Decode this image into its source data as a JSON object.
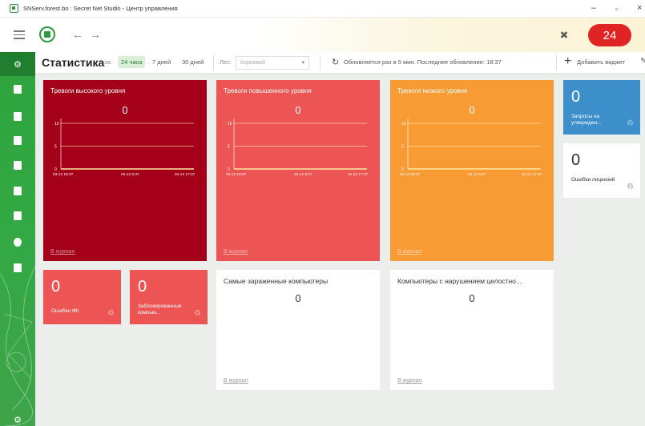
{
  "window": {
    "title": "SNServ.forest.bo : Secret Net Studio - Центр управления",
    "minimize": "–",
    "restore": "▫",
    "close": "×"
  },
  "topbar": {
    "notification_count": "24",
    "back_arrow": "←",
    "forward_arrow": "→"
  },
  "header": {
    "title": "Статистика",
    "for_label": "за:",
    "ranges": [
      "24 часа",
      "7 дней",
      "30 дней"
    ],
    "forest_label": "Лес:",
    "forest_value": "Корневой",
    "refresh_text": "Обновляется раз в 5 мин. Последнее обновление: 18:37",
    "add_widget": "Добавить виджет"
  },
  "colors": {
    "high": "#a4001a",
    "elevated": "#ed5454",
    "low": "#f99b35",
    "blue": "#3d8fcb",
    "sidebar": "#2ea43d",
    "badge": "#e02424"
  },
  "alert_cards": [
    {
      "title": "Тревоги высокого уровня",
      "value": "0",
      "y_ticks": [
        "10",
        "5",
        "0"
      ],
      "x_ticks": [
        "03.12 18:37",
        "04.12 6:37",
        "04.12 17:37"
      ],
      "journal": "В журнал"
    },
    {
      "title": "Тревоги повышенного уровня",
      "value": "0",
      "y_ticks": [
        "10",
        "5",
        "0"
      ],
      "x_ticks": [
        "03.12 18:37",
        "04.12 6:37",
        "04.12 17:37"
      ],
      "journal": "В журнал"
    },
    {
      "title": "Тревоги низкого уровня",
      "value": "0",
      "y_ticks": [
        "10",
        "5",
        "0"
      ],
      "x_ticks": [
        "03.12 18:37",
        "04.12 6:37",
        "04.12 17:37"
      ],
      "journal": "В журнал"
    }
  ],
  "small_cards": [
    {
      "value": "0",
      "label": "Запросы на утвержден...",
      "icon": "network-icon"
    },
    {
      "value": "0",
      "label": "Ошибки лицензий",
      "icon": "network-icon"
    },
    {
      "value": "0",
      "label": "Ошибки ФК",
      "icon": "network-icon"
    },
    {
      "value": "0",
      "label": "Заблокированные компью...",
      "icon": "network-icon"
    }
  ],
  "white_cards": [
    {
      "title": "Самые зараженные компьютеры",
      "value": "0",
      "journal": "В журнал"
    },
    {
      "title": "Компьютеры с нарушением целостно...",
      "value": "0",
      "journal": "В журнал"
    }
  ]
}
